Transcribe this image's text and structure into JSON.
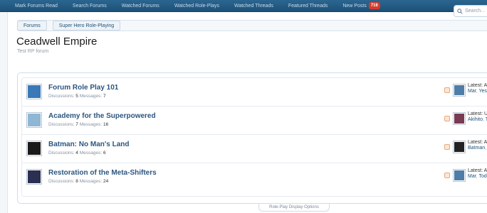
{
  "nav": {
    "links": [
      "Mark Forums Read",
      "Search Forums",
      "Watched Forums",
      "Watched Role-Plays",
      "Watched Threads",
      "Featured Threads",
      "New Posts"
    ],
    "new_posts_count": "716",
    "search_placeholder": "Search..."
  },
  "breadcrumb": [
    "Forums",
    "Super Hero Role-Playing"
  ],
  "page": {
    "title": "Ceadwell Empire",
    "subtitle": "Test RP forum"
  },
  "stats_labels": {
    "discussions": "Discussions:",
    "messages": "Messages:"
  },
  "forums": [
    {
      "name": "Forum Role Play 101",
      "discussions": "5",
      "messages": "7",
      "latest_label": "Latest: Ad",
      "latest_user": "Mar",
      "latest_time": "Yeste",
      "thumb_color": "#3a78b8",
      "latest_color": "#4e7ea8"
    },
    {
      "name": "Academy for the Superpowered",
      "discussions": "7",
      "messages": "16",
      "latest_label": "Latest: Up",
      "latest_user": "Akihito",
      "latest_time": "To",
      "thumb_color": "#8fb7d4",
      "latest_color": "#7a3a52"
    },
    {
      "name": "Batman: No Man's Land",
      "discussions": "4",
      "messages": "6",
      "latest_label": "Latest: Ap",
      "latest_user": "Batman",
      "latest_time": "Y",
      "thumb_color": "#1a1a1a",
      "latest_color": "#222222"
    },
    {
      "name": "Restoration of the Meta-Shifters",
      "discussions": "8",
      "messages": "24",
      "latest_label": "Latest: Ad",
      "latest_user": "Mar",
      "latest_time": "Toda",
      "thumb_color": "#2b2f52",
      "latest_color": "#4e7ea8"
    }
  ],
  "options_label": "Role-Play Display Options"
}
